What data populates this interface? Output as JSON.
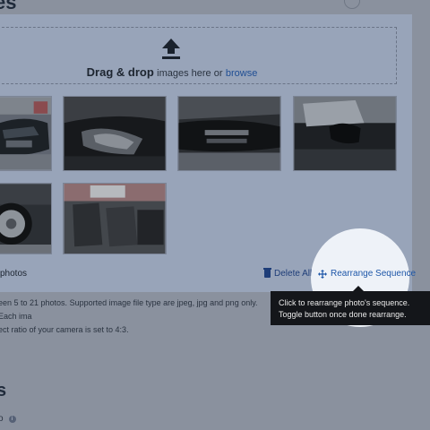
{
  "header": {
    "title_fragment": "es"
  },
  "upload": {
    "drag_drop": "Drag & drop",
    "images_here_or": "images here or",
    "browse_link": "browse"
  },
  "photos": [
    {
      "name": "car-front-left-silver"
    },
    {
      "name": "car-headlight-closeup"
    },
    {
      "name": "car-front-bumper-closeup"
    },
    {
      "name": "car-side-mirror-closeup"
    },
    {
      "name": "car-wheel-closeup"
    },
    {
      "name": "car-interior-seats"
    }
  ],
  "footer": {
    "photo_count_fragment": "photos",
    "delete_all": "Delete All",
    "rearrange_sequence": "Rearrange Sequence"
  },
  "tooltip": {
    "text": "Click to rearrange photo's sequence. Toggle button once done rearrange."
  },
  "note": {
    "line1": "een 5 to 21 photos. Supported image file type are jpeg, jpg and png only. Each ima",
    "line2": "ect ratio of your camera is set to 4:3."
  },
  "section2": {
    "title_fragment": "s"
  },
  "bottom": {
    "label_fragment": "o"
  },
  "colors": {
    "overlay": "#8a919e",
    "card": "#98a4b9",
    "link": "#1f4e94",
    "tooltip_bg": "#14161a",
    "spotlight": "#eef2f8"
  }
}
